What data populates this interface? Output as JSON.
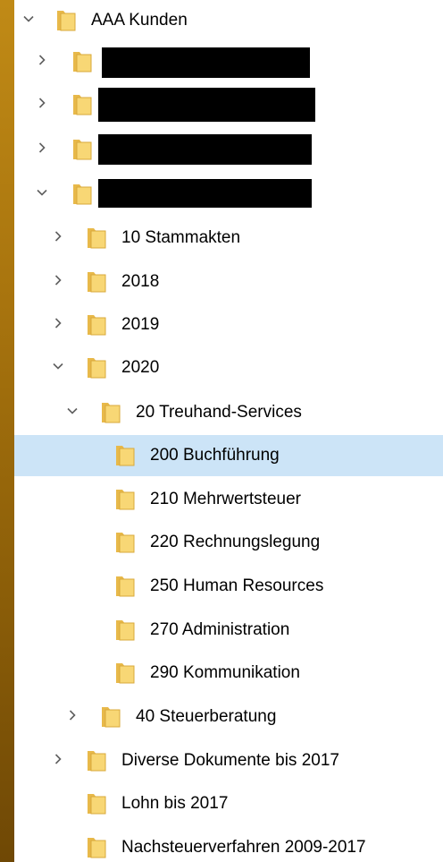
{
  "colors": {
    "selection": "#cce4f7",
    "folder": "#f8d775",
    "folder_shade": "#e8b94a",
    "chevron": "#5f5f5f",
    "redaction": "#000000"
  },
  "tree": {
    "items": [
      {
        "label": "AAA Kunden",
        "expander": "expanded",
        "icon": "folder-icon"
      },
      {
        "label": "",
        "expander": "collapsed",
        "icon": "folder-icon",
        "redacted": true
      },
      {
        "label": "",
        "expander": "collapsed",
        "icon": "folder-icon",
        "redacted": true
      },
      {
        "label": "",
        "expander": "collapsed",
        "icon": "folder-icon",
        "redacted": true
      },
      {
        "label": "",
        "expander": "expanded",
        "icon": "folder-icon",
        "redacted": true
      },
      {
        "label": "10 Stammakten",
        "expander": "collapsed",
        "icon": "folder-icon"
      },
      {
        "label": "2018",
        "expander": "collapsed",
        "icon": "folder-icon"
      },
      {
        "label": "2019",
        "expander": "collapsed",
        "icon": "folder-icon"
      },
      {
        "label": "2020",
        "expander": "expanded",
        "icon": "folder-icon"
      },
      {
        "label": "20 Treuhand-Services",
        "expander": "expanded",
        "icon": "folder-icon"
      },
      {
        "label": "200 Buchführung",
        "expander": "none",
        "icon": "folder-icon",
        "selected": true
      },
      {
        "label": "210 Mehrwertsteuer",
        "expander": "none",
        "icon": "folder-icon"
      },
      {
        "label": "220 Rechnungslegung",
        "expander": "none",
        "icon": "folder-icon"
      },
      {
        "label": "250 Human Resources",
        "expander": "none",
        "icon": "folder-icon"
      },
      {
        "label": "270 Administration",
        "expander": "none",
        "icon": "folder-icon"
      },
      {
        "label": "290 Kommunikation",
        "expander": "none",
        "icon": "folder-icon"
      },
      {
        "label": "40 Steuerberatung",
        "expander": "collapsed",
        "icon": "folder-icon"
      },
      {
        "label": "Diverse Dokumente bis 2017",
        "expander": "collapsed",
        "icon": "folder-icon"
      },
      {
        "label": "Lohn bis 2017",
        "expander": "none",
        "icon": "folder-icon"
      },
      {
        "label": "Nachsteuerverfahren 2009-2017",
        "expander": "none",
        "icon": "folder-icon"
      }
    ]
  }
}
